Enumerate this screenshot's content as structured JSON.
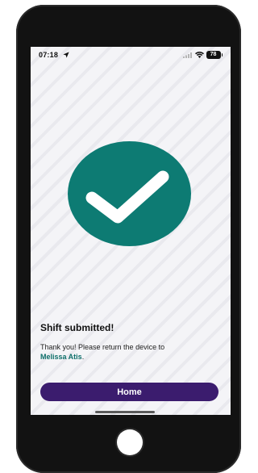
{
  "status_bar": {
    "time": "07:18",
    "battery": "78",
    "icons": [
      "location-arrow-icon",
      "signal-icon",
      "wifi-icon",
      "battery-icon"
    ]
  },
  "confirmation": {
    "icon": "check-circle-icon",
    "title": "Shift submitted!",
    "message_prefix": "Thank you! Please return the device to",
    "recipient_name": "Melissa Atis",
    "message_suffix": "."
  },
  "actions": {
    "home_label": "Home"
  },
  "colors": {
    "accent_teal": "#0d7b73",
    "button_purple": "#3b1c6e",
    "name_teal": "#0d6e69"
  }
}
